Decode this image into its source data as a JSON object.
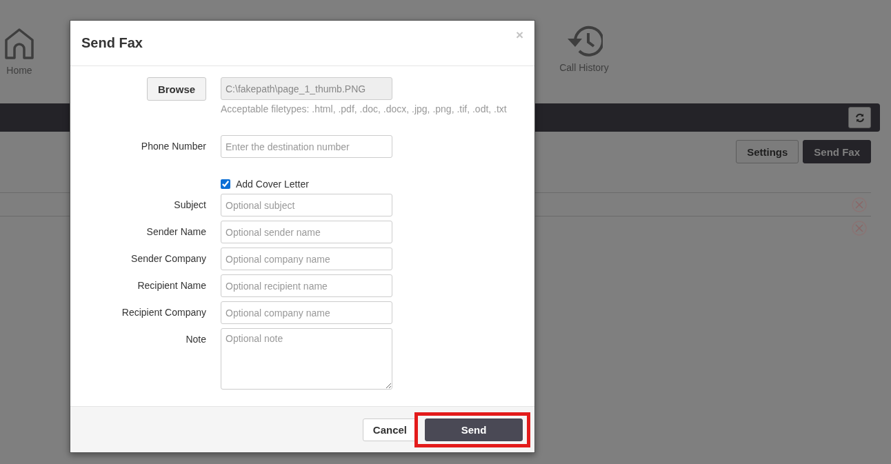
{
  "background": {
    "nav": [
      {
        "label": "Home",
        "kind": "home"
      },
      {
        "label": "Call History",
        "kind": "history"
      }
    ],
    "buttons": [
      {
        "label": "Settings",
        "kind": "secondary"
      },
      {
        "label": "Send Fax",
        "kind": "primary"
      }
    ]
  },
  "dialog": {
    "title": "Send Fax",
    "close": "×",
    "file": {
      "button": "Browse",
      "value": "C:\\fakepath\\page_1_thumb.PNG",
      "readonly": true,
      "hint": "Acceptable filetypes: .html, .pdf, .doc, .docx, .jpg, .png, .tif, .odt, .txt"
    },
    "phone": {
      "label": "Phone Number",
      "placeholder": "Enter the destination number"
    },
    "cover_letter": {
      "label": "Add Cover Letter",
      "checked": true
    },
    "fields": [
      {
        "label": "Subject",
        "placeholder": "Optional subject",
        "kind": "input"
      },
      {
        "label": "Sender Name",
        "placeholder": "Optional sender name",
        "kind": "input"
      },
      {
        "label": "Sender Company",
        "placeholder": "Optional company name",
        "kind": "input"
      },
      {
        "label": "Recipient Name",
        "placeholder": "Optional recipient name",
        "kind": "input"
      },
      {
        "label": "Recipient Company",
        "placeholder": "Optional company name",
        "kind": "input"
      },
      {
        "label": "Note",
        "placeholder": "Optional note",
        "kind": "textarea"
      }
    ],
    "footer": {
      "buttons": [
        {
          "label": "Cancel",
          "kind": "default",
          "highlighted": false
        },
        {
          "label": "Send",
          "kind": "primary",
          "highlighted": true
        }
      ]
    }
  }
}
